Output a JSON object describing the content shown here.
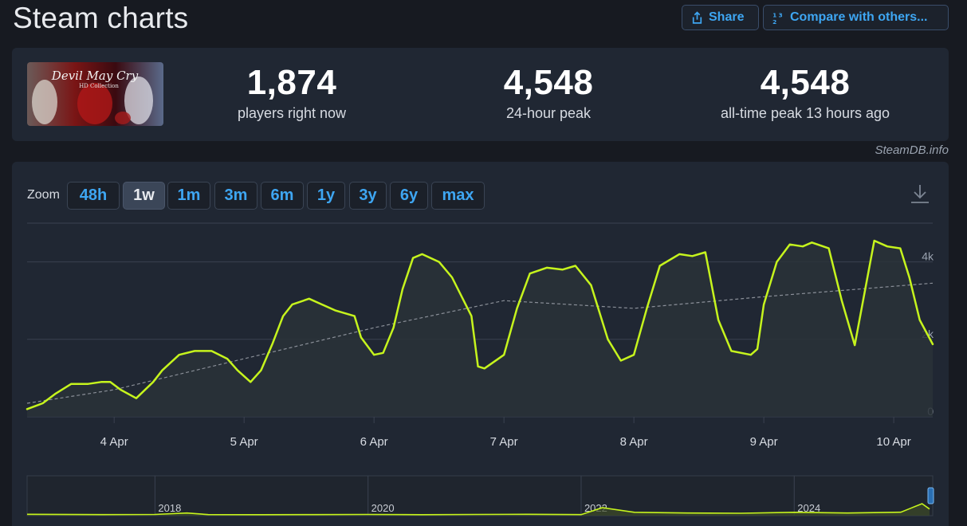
{
  "header": {
    "title": "Steam charts",
    "share_label": "Share",
    "compare_label": "Compare with others..."
  },
  "stats": {
    "current": {
      "value": "1,874",
      "label": "players right now"
    },
    "peak24": {
      "value": "4,548",
      "label": "24-hour peak"
    },
    "alltime": {
      "value": "4,548",
      "label": "all-time peak 13 hours ago"
    }
  },
  "cover": {
    "title_text": "Devil May Cry",
    "subtitle_text": "HD Collection"
  },
  "watermark": "SteamDB.info",
  "zoom": {
    "label": "Zoom",
    "options": [
      "48h",
      "1w",
      "1m",
      "3m",
      "6m",
      "1y",
      "3y",
      "6y",
      "max"
    ],
    "active": "1w"
  },
  "colors": {
    "line": "#c6f41d",
    "average": "#8a8f98",
    "grid": "#3a4150",
    "accent": "#3ea6f2"
  },
  "chart_data": [
    {
      "type": "line",
      "series": [
        {
          "values_note_x_unit": "days",
          "x": [
            3.33,
            3.45,
            3.55,
            3.67,
            3.8,
            3.9,
            3.97,
            4.05,
            4.17,
            4.3,
            4.37,
            4.5,
            4.62,
            4.75,
            4.87,
            4.95,
            5.05,
            5.13,
            5.22,
            5.3,
            5.37,
            5.5,
            5.6,
            5.7,
            5.85,
            5.9,
            6.0,
            6.07,
            6.15,
            6.22,
            6.3,
            6.37,
            6.5,
            6.6,
            6.75,
            6.8,
            6.85,
            7.0,
            7.1,
            7.2,
            7.33,
            7.45,
            7.55,
            7.67,
            7.8,
            7.9,
            8.0,
            8.1,
            8.2,
            8.35,
            8.45,
            8.55,
            8.65,
            8.75,
            8.9,
            8.95,
            9.0,
            9.1,
            9.2,
            9.3,
            9.37,
            9.5,
            9.6,
            9.7,
            9.85,
            9.95,
            10.05,
            10.12,
            10.2,
            10.3
          ],
          "values": [
            200,
            350,
            600,
            850,
            850,
            900,
            900,
            700,
            480,
            900,
            1200,
            1600,
            1700,
            1700,
            1500,
            1200,
            900,
            1200,
            1900,
            2600,
            2900,
            3050,
            2900,
            2750,
            2600,
            2050,
            1600,
            1650,
            2300,
            3300,
            4100,
            4200,
            4000,
            3600,
            2600,
            1300,
            1250,
            1600,
            2800,
            3700,
            3850,
            3800,
            3900,
            3400,
            2000,
            1450,
            1600,
            2800,
            3900,
            4200,
            4150,
            4250,
            2500,
            1700,
            1600,
            1750,
            2900,
            4000,
            4450,
            4400,
            4500,
            4350,
            3000,
            1850,
            4548,
            4400,
            4350,
            3600,
            2500,
            1874
          ]
        },
        {
          "x": [
            3.33,
            4.0,
            5.0,
            6.0,
            7.0,
            8.0,
            9.0,
            10.3
          ],
          "values": [
            350,
            700,
            1500,
            2300,
            3000,
            2800,
            3100,
            3450
          ]
        }
      ],
      "x_ticks": [
        "4 Apr",
        "5 Apr",
        "6 Apr",
        "7 Apr",
        "8 Apr",
        "9 Apr",
        "10 Apr"
      ],
      "x_tick_values": [
        4,
        5,
        6,
        7,
        8,
        9,
        10
      ],
      "y_ticks": [
        "0",
        "2k",
        "4k"
      ],
      "y_tick_values": [
        0,
        2000,
        4000
      ],
      "ylim": [
        0,
        5000
      ],
      "xlim": [
        3.33,
        10.3
      ],
      "grid": true
    },
    {
      "type": "area",
      "series": [
        {
          "x": [
            2016.8,
            2017.5,
            2018.0,
            2018.3,
            2018.5,
            2019.0,
            2019.5,
            2020.0,
            2020.5,
            2021.0,
            2021.5,
            2022.0,
            2022.2,
            2022.5,
            2023.0,
            2023.5,
            2024.0,
            2024.5,
            2025.0,
            2025.2,
            2025.27
          ],
          "values": [
            100,
            80,
            90,
            200,
            80,
            70,
            80,
            90,
            70,
            90,
            100,
            80,
            600,
            250,
            200,
            180,
            250,
            200,
            260,
            900,
            500
          ]
        }
      ],
      "x_ticks": [
        "2018",
        "2020",
        "2022",
        "2024"
      ],
      "x_tick_values": [
        2018,
        2020,
        2022,
        2024
      ],
      "xlim": [
        2016.8,
        2025.3
      ],
      "ylim": [
        0,
        3000
      ]
    }
  ]
}
